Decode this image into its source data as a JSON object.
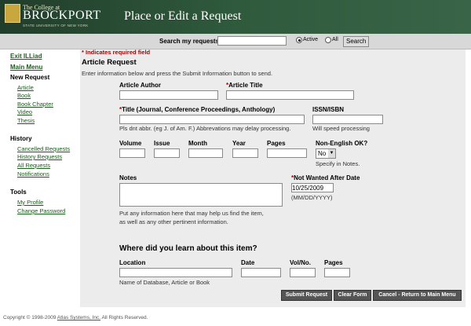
{
  "header": {
    "logo_small": "The College at",
    "logo_big": "BROCKPORT",
    "logo_sub": "STATE UNIVERSITY OF NEW YORK",
    "title": "Place or Edit a Request"
  },
  "search": {
    "label": "Search my requests:",
    "value": "",
    "radio_active": "Active",
    "radio_all": "All",
    "selected": "Active",
    "button": "Search"
  },
  "sidebar": {
    "exit": "Exit ILLiad",
    "main_menu": "Main Menu",
    "new_request": {
      "heading": "New Request",
      "items": [
        "Article",
        "Book",
        "Book Chapter",
        "Video",
        "Thesis"
      ]
    },
    "history": {
      "heading": "History",
      "items": [
        "Cancelled Requests",
        "History Requests",
        "All Requests",
        "Notifications"
      ]
    },
    "tools": {
      "heading": "Tools",
      "items": [
        "My Profile",
        "Change Password"
      ]
    }
  },
  "form": {
    "required_note": "* Indicates required field",
    "heading": "Article Request",
    "instructions": "Enter information below and press the Submit Information button to send.",
    "article_author": {
      "label": "Article Author",
      "value": ""
    },
    "article_title": {
      "star": "*",
      "label": "Article Title",
      "value": ""
    },
    "journal_title": {
      "star": "*",
      "label": "Title (Journal, Conference Proceedings, Anthology)",
      "value": "",
      "help": "Pls dnt abbr. (eg J. of Am. F.) Abbrevations may delay processing."
    },
    "issn": {
      "label": "ISSN/ISBN",
      "value": "",
      "help": "Will speed processing"
    },
    "volume": {
      "label": "Volume",
      "value": ""
    },
    "issue": {
      "label": "Issue",
      "value": ""
    },
    "month": {
      "label": "Month",
      "value": ""
    },
    "year": {
      "label": "Year",
      "value": ""
    },
    "pages": {
      "label": "Pages",
      "value": ""
    },
    "non_english": {
      "label": "Non-English OK?",
      "value": "No",
      "help": "Specify in Notes."
    },
    "notes": {
      "label": "Notes",
      "value": "",
      "help1": "Put any information here that may help us find the item,",
      "help2": "as well as any other pertinent information."
    },
    "not_wanted": {
      "star": "*",
      "label": "Not Wanted After Date",
      "value": "10/25/2009",
      "help": "(MM/DD/YYYY)"
    },
    "learn_heading": "Where did you learn about this item?",
    "location": {
      "label": "Location",
      "value": "",
      "help": "Name of Database, Article or Book"
    },
    "date": {
      "label": "Date",
      "value": ""
    },
    "volno": {
      "label": "Vol/No.",
      "value": ""
    },
    "cite_pages": {
      "label": "Pages",
      "value": ""
    },
    "buttons": {
      "submit": "Submit Request",
      "clear": "Clear Form",
      "cancel": "Cancel - Return to Main Menu"
    }
  },
  "footer": {
    "prefix": "Copyright © 1998-2009 ",
    "link": "Atlas Systems, Inc.",
    "suffix": " All Rights Reserved."
  }
}
